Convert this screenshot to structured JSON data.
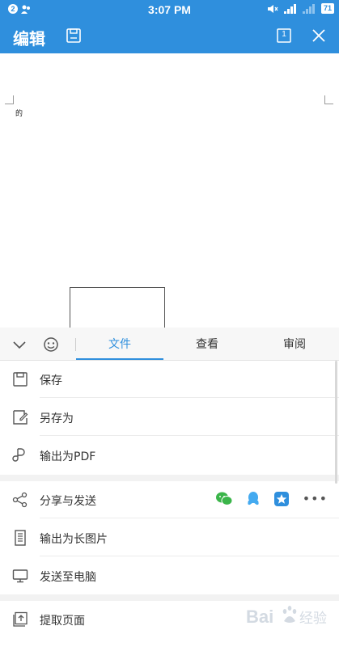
{
  "status": {
    "notification_count": "2",
    "time": "3:07 PM",
    "signal_small": "4G",
    "battery": "71"
  },
  "appbar": {
    "title": "编辑",
    "page_number": "1"
  },
  "document": {
    "text": "的"
  },
  "tabs": {
    "items": [
      "文件",
      "查看",
      "审阅"
    ],
    "active": "文件"
  },
  "menu": {
    "save": "保存",
    "save_as": "另存为",
    "export_pdf": "输出为PDF",
    "share": "分享与发送",
    "export_long_image": "输出为长图片",
    "send_to_pc": "发送至电脑",
    "extract_pages": "提取页面"
  },
  "share_targets": [
    "wechat-icon",
    "qq-icon",
    "tim-icon",
    "more-icon"
  ],
  "watermark": {
    "text": "Bai",
    "text2": "经验"
  },
  "colors": {
    "accent": "#2f8fdd",
    "arrow": "#cc0000",
    "wechat": "#3bb54a",
    "qq": "#44aaf0"
  }
}
